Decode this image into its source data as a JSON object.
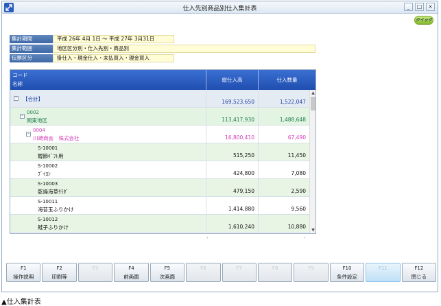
{
  "window": {
    "title": "仕入先別商品別仕入集計表",
    "help_button": "クイック"
  },
  "conditions": [
    {
      "label": "集計期間",
      "value": "平成 26年 4月 1日 〜 平成 27年 3月31日"
    },
    {
      "label": "集計範囲",
      "value": "地区区分別・仕入先別・商品別"
    },
    {
      "label": "伝票区分",
      "value": "掛仕入・現金仕入・未払買入・現金買入"
    }
  ],
  "grid": {
    "header": {
      "code": "コード",
      "name": "名称",
      "total_amount": "総仕入高",
      "quantity": "仕入数量"
    },
    "total_row": {
      "label": "【合計】",
      "amount": "169,523,650",
      "quantity": "1,522,047"
    },
    "region_row": {
      "code": "0002",
      "name": "関東地区",
      "amount": "113,417,930",
      "quantity": "1,488,648"
    },
    "customer_row": {
      "code": "0004",
      "name": "川崎商会　株式会社",
      "amount": "16,800,410",
      "quantity": "67,490"
    },
    "items": [
      {
        "code": "S-10001",
        "name": "鰹節ｷﾞﾌﾄ用",
        "amount": "515,250",
        "quantity": "11,450"
      },
      {
        "code": "S-10002",
        "name": "ﾌﾞｲﾖﾝ",
        "amount": "424,800",
        "quantity": "7,080"
      },
      {
        "code": "S-10003",
        "name": "乾燥海草ｻﾗﾀﾞ",
        "amount": "479,150",
        "quantity": "2,590"
      },
      {
        "code": "S-10011",
        "name": "海苔玉ふりかけ",
        "amount": "1,414,880",
        "quantity": "9,560"
      },
      {
        "code": "S-10012",
        "name": "鮭子ふりかけ",
        "amount": "1,610,240",
        "quantity": "10,880"
      }
    ]
  },
  "function_keys": [
    {
      "num": "F1",
      "label": "操作説明",
      "state": "enabled"
    },
    {
      "num": "F2",
      "label": "印刷等",
      "state": "enabled"
    },
    {
      "num": "F3",
      "label": "",
      "state": "disabled"
    },
    {
      "num": "F4",
      "label": "前画面",
      "state": "enabled"
    },
    {
      "num": "F5",
      "label": "次画面",
      "state": "enabled"
    },
    {
      "num": "F6",
      "label": "",
      "state": "disabled"
    },
    {
      "num": "F7",
      "label": "",
      "state": "disabled"
    },
    {
      "num": "F8",
      "label": "",
      "state": "disabled"
    },
    {
      "num": "F9",
      "label": "",
      "state": "disabled"
    },
    {
      "num": "F10",
      "label": "条件設定",
      "state": "enabled"
    },
    {
      "num": "F11",
      "label": "",
      "state": "highlight"
    },
    {
      "num": "F12",
      "label": "閉じる",
      "state": "enabled"
    }
  ],
  "caption": "▲仕入集計表",
  "colors": {
    "header_blue": "#2a5cc0",
    "total_text": "#2343a8",
    "region_text": "#1d7c4a",
    "customer_text": "#d43ab8",
    "condition_label": "#4a73b0",
    "condition_value_bg": "#fffcd6"
  },
  "icons": {
    "app": "expand-arrows-icon",
    "tree": "tree-collapse-icon"
  }
}
